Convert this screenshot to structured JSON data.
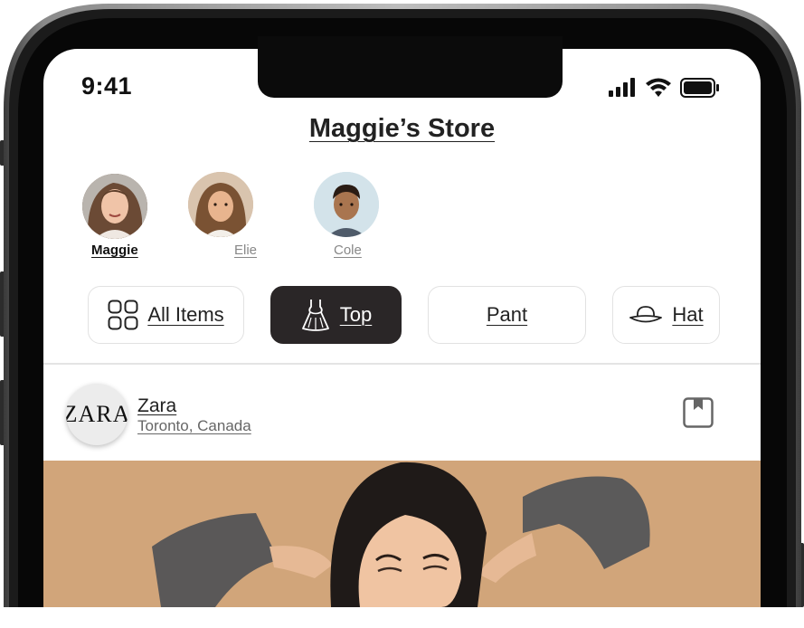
{
  "status_bar": {
    "time": "9:41"
  },
  "header": {
    "title": "Maggie’s Store"
  },
  "profiles": [
    {
      "name": "Maggie",
      "selected": true
    },
    {
      "name": "Elie",
      "selected": false
    },
    {
      "name": "Cole",
      "selected": false
    }
  ],
  "categories": [
    {
      "label": "All Items",
      "icon": "grid-icon",
      "active": false
    },
    {
      "label": "Top",
      "icon": "dress-icon",
      "active": true
    },
    {
      "label": "Pant",
      "icon": "",
      "active": false
    },
    {
      "label": "Hat",
      "icon": "hat-icon",
      "active": false
    }
  ],
  "post": {
    "store_logo_text": "ZARA",
    "store_name": "Zara",
    "location": "Toronto, Canada",
    "bookmark_icon": "bookmark-icon"
  },
  "colors": {
    "active_chip": "#2a2627",
    "photo_background": "#d2a77b",
    "frame": "#1a1a1a"
  }
}
